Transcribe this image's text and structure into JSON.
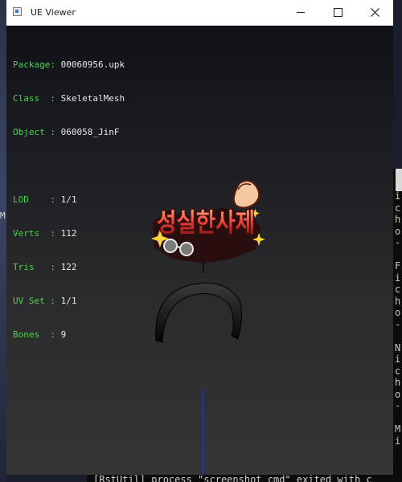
{
  "window": {
    "title": "UE Viewer",
    "minimize_symbol": "—",
    "maximize_symbol": "☐",
    "close_symbol": "✕"
  },
  "info": {
    "package_label": "Package:",
    "package_value": "00060956.upk",
    "class_label": "Class  :",
    "class_value": "SkeletalMesh",
    "object_label": "Object :",
    "object_value": "060058_JinF",
    "lod_label": "LOD    :",
    "lod_value": "1/1",
    "verts_label": "Verts  :",
    "verts_value": "112",
    "tris_label": "Tris   :",
    "tris_value": "122",
    "uvset_label": "UV Set :",
    "uvset_value": "1/1",
    "bones_label": "Bones  :",
    "bones_value": "9"
  },
  "logo_text": "성실한사제",
  "desktop": {
    "left_mark": "M",
    "console_lines": [
      "i",
      "c",
      "h",
      "o",
      "-",
      "",
      "F",
      "i",
      "c",
      "h",
      "o",
      "-",
      "",
      "N",
      "i",
      "c",
      "h",
      "o",
      "-",
      "",
      "M",
      "i"
    ],
    "console_bottom": "[RstUtil] process \"screenshot_cmd\" exited with c"
  },
  "colors": {
    "label_green": "#46d846",
    "value_white": "#e8e8e8",
    "axis_blue": "#1f3cc8"
  }
}
